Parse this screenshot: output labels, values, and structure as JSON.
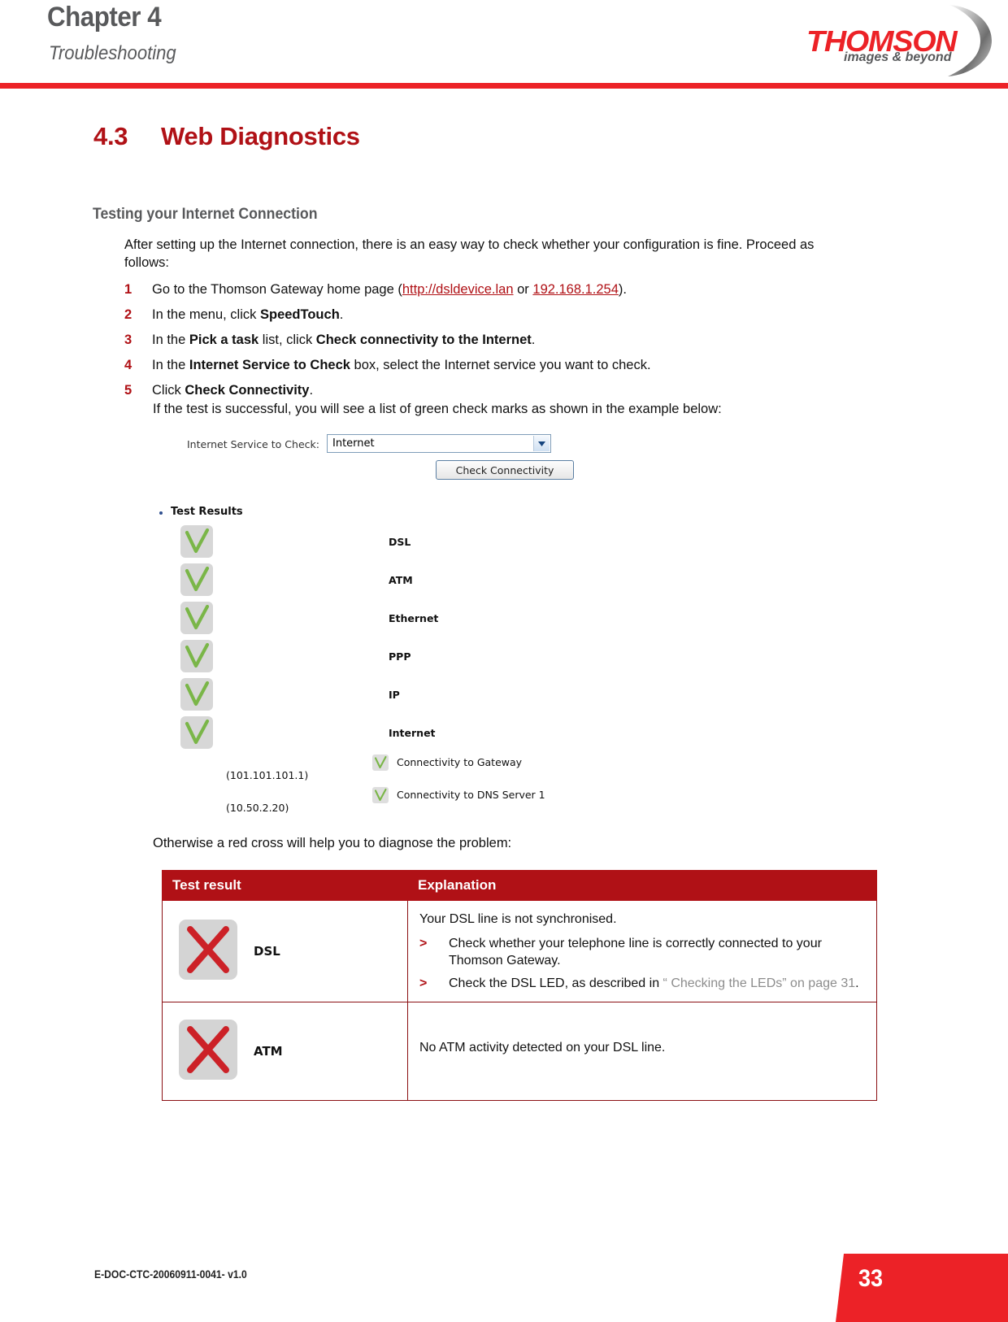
{
  "header": {
    "chapter": "Chapter 4",
    "subtitle": "Troubleshooting",
    "logo_name": "THOMSON",
    "logo_tagline": "images & beyond",
    "accent_red": "#ec2227",
    "heading_grey": "#58595b"
  },
  "section": {
    "number": "4.3",
    "title": "Web Diagnostics",
    "title_color": "#b01116"
  },
  "body": {
    "sub_head": "Testing your Internet Connection",
    "intro": "After setting up the Internet connection, there is an easy way to check whether your configuration is fine. Proceed as follows:",
    "steps": [
      {
        "num": "1",
        "html": "Go to the Thomson Gateway home page (<a class=\"doclink\" data-name=\"link-dsldevice-lan\" data-interactable=\"true\">http://dsldevice.lan</a> or <a class=\"doclink\" data-name=\"link-ip-address\" data-interactable=\"true\">192.168.1.254</a>)."
      },
      {
        "num": "2",
        "html": "In the menu, click <b>SpeedTouch</b>."
      },
      {
        "num": "3",
        "html": "In the <b>Pick a task</b> list, click <b>Check connectivity to the Internet</b>."
      },
      {
        "num": "4",
        "html": "In the <b>Internet Service to Check</b> box, select the Internet service you want to check."
      },
      {
        "num": "5",
        "html": "Click <b>Check Connectivity</b>."
      }
    ],
    "success_note": "If the test is successful, you will see a list of green check marks as shown in the example below:",
    "otherwise_note": "Otherwise a red cross will help you to diagnose the problem:"
  },
  "app_screenshot": {
    "service_label": "Internet Service to Check:",
    "service_selected": "Internet",
    "check_button": "Check Connectivity",
    "results_heading": "Test Results",
    "check_color": "#7ab648",
    "results": [
      {
        "label": "DSL",
        "status": "pass"
      },
      {
        "label": "ATM",
        "status": "pass"
      },
      {
        "label": "Ethernet",
        "status": "pass"
      },
      {
        "label": "PPP",
        "status": "pass"
      },
      {
        "label": "IP",
        "status": "pass"
      },
      {
        "label": "Internet",
        "status": "pass"
      }
    ],
    "sub_results": [
      {
        "label": "Connectivity to Gateway",
        "address": "(101.101.101.1)",
        "status": "pass"
      },
      {
        "label": "Connectivity to DNS Server 1",
        "address": "(10.50.2.20)",
        "status": "pass"
      }
    ]
  },
  "table": {
    "header_bg": "#b01116",
    "columns": [
      "Test result",
      "Explanation"
    ],
    "rows": [
      {
        "icon_label": "DSL",
        "icon_status": "fail",
        "lead": "Your DSL line is not synchronised.",
        "items": [
          {
            "marker": ">",
            "html": "Check whether your telephone line is correctly connected to your Thomson Gateway."
          },
          {
            "marker": ">",
            "html": "Check the DSL LED, as described in <span class=\"xref\">“ Checking the LEDs” on page 31</span>."
          }
        ]
      },
      {
        "icon_label": "ATM",
        "icon_status": "fail",
        "lead": "No ATM activity detected on your DSL line.",
        "items": []
      }
    ]
  },
  "footer": {
    "doc_id": "E-DOC-CTC-20060911-0041- v1.0",
    "page_number": "33"
  }
}
